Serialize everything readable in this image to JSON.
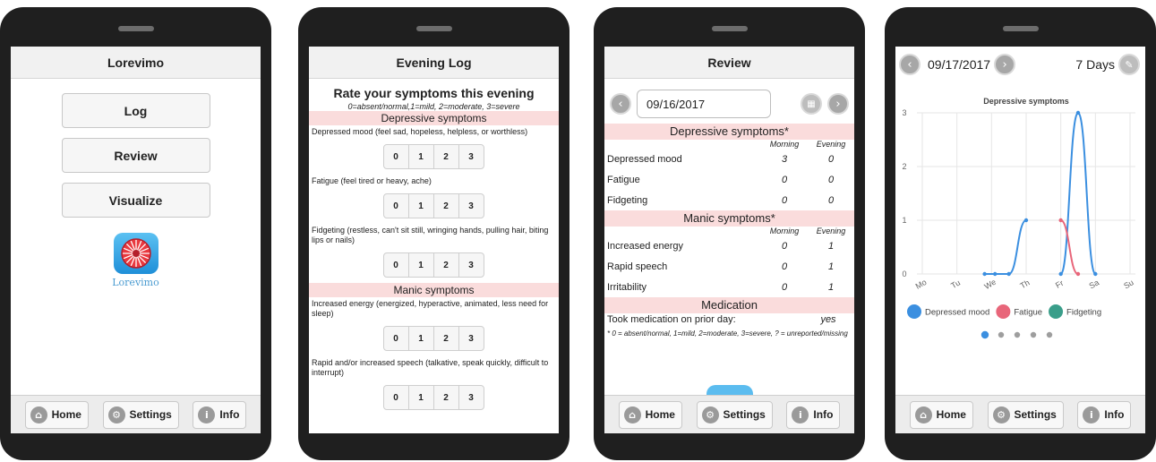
{
  "common": {
    "footer": {
      "home": "Home",
      "settings": "Settings",
      "info": "Info"
    }
  },
  "phone1": {
    "header": "Lorevimo",
    "buttons": [
      "Log",
      "Review",
      "Visualize"
    ],
    "logo_text": "Lorevimo"
  },
  "phone2": {
    "header": "Evening Log",
    "title": "Rate your symptoms this evening",
    "scale": "0=absent/normal,1=mild, 2=moderate, 3=severe",
    "section_depressive": "Depressive symptoms",
    "section_manic": "Manic symptoms",
    "rating_options": [
      "0",
      "1",
      "2",
      "3"
    ],
    "questions": [
      "Depressed mood (feel sad, hopeless, helpless, or worthless)",
      "Fatigue (feel tired or heavy, ache)",
      "Fidgeting (restless, can't sit still, wringing hands, pulling hair, biting lips or nails)",
      "Increased energy (energized, hyperactive, animated, less need for sleep)",
      "Rapid and/or increased speech (talkative, speak quickly, difficult to interrupt)"
    ]
  },
  "phone3": {
    "header": "Review",
    "date": "09/16/2017",
    "section_depressive": "Depressive symptoms*",
    "section_manic": "Manic symptoms*",
    "section_medication": "Medication",
    "col_morning": "Morning",
    "col_evening": "Evening",
    "depressive_rows": [
      {
        "label": "Depressed mood",
        "morning": "3",
        "evening": "0"
      },
      {
        "label": "Fatigue",
        "morning": "0",
        "evening": "0"
      },
      {
        "label": "Fidgeting",
        "morning": "0",
        "evening": "0"
      }
    ],
    "manic_rows": [
      {
        "label": "Increased energy",
        "morning": "0",
        "evening": "1"
      },
      {
        "label": "Rapid speech",
        "morning": "0",
        "evening": "1"
      },
      {
        "label": "Irritability",
        "morning": "0",
        "evening": "1"
      }
    ],
    "medication_label": "Took medication on prior day:",
    "medication_value": "yes",
    "footnote": "* 0 = absent/normal, 1=mild, 2=moderate, 3=severe, ? = unreported/missing"
  },
  "phone4": {
    "date": "09/17/2017",
    "range": "7 Days",
    "chart_data": {
      "type": "line",
      "title": "Depressive symptoms",
      "categories": [
        "Mo",
        "Tu",
        "We",
        "Th",
        "Fr",
        "Sa",
        "Su"
      ],
      "ylim": [
        0,
        3
      ],
      "yticks": [
        "0",
        "1",
        "2",
        "3"
      ],
      "series": [
        {
          "name": "Depressed mood",
          "color": "#3b8fe0",
          "points": [
            [
              1.8,
              0
            ],
            [
              2.1,
              0
            ],
            [
              2.5,
              0
            ],
            [
              3.0,
              1
            ],
            null,
            [
              4.0,
              0
            ],
            [
              4.5,
              3
            ],
            [
              5.0,
              0
            ]
          ]
        },
        {
          "name": "Fatigue",
          "color": "#e8667a",
          "points": [
            [
              4.0,
              1
            ],
            [
              4.5,
              0
            ]
          ]
        },
        {
          "name": "Fidgeting",
          "color": "#3a9e8a",
          "points": []
        }
      ],
      "legend_position": "bottom",
      "grid": true
    },
    "pager_dots": 5,
    "pager_active": 0
  }
}
